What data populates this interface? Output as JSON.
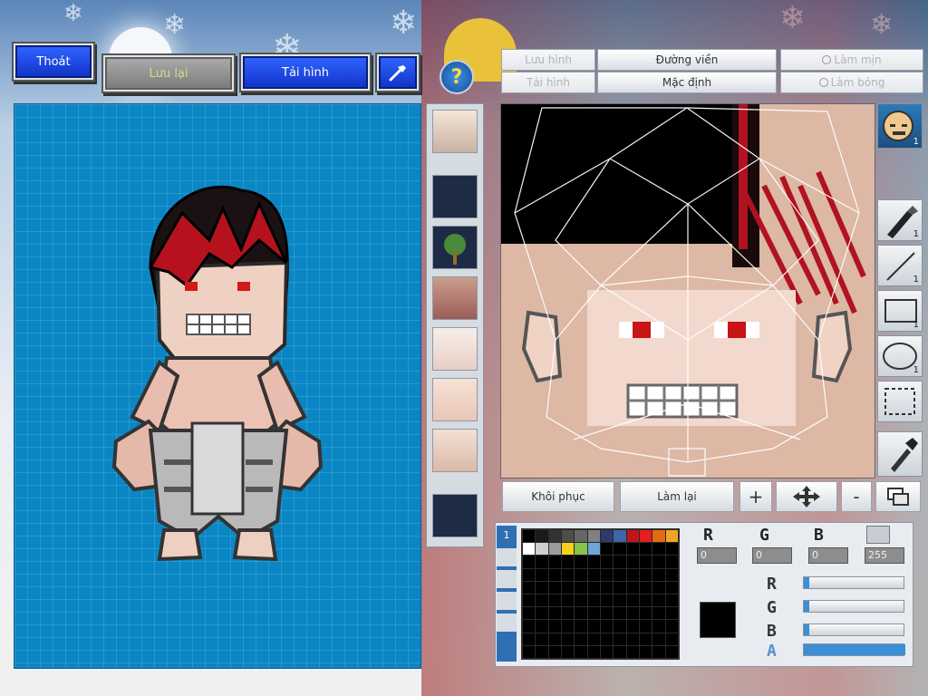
{
  "top_left": {
    "exit_label": "Thoát",
    "save_label": "Lưu lại",
    "reload_label": "Tải hình"
  },
  "top_right": {
    "save_image": "Lưu hình",
    "outline": "Đường viền",
    "smooth": "Làm mịn",
    "reload_image": "Tải hình",
    "default": "Mặc định",
    "shine": "Làm bóng"
  },
  "tools": {
    "face_count": "1",
    "pen_count": "1",
    "line_count": "1",
    "rect_count": "1",
    "ellipse_count": "1"
  },
  "bottom_toolbar": {
    "restore": "Khôi phục",
    "redo": "Làm lại",
    "zoom_in": "+",
    "zoom_out": "-"
  },
  "palette_tabs": [
    "1"
  ],
  "color_channels": {
    "r_label": "R",
    "g_label": "G",
    "b_label": "B",
    "r_value": "0",
    "g_value": "0",
    "b_value": "0",
    "a_value": "255"
  },
  "sliders": {
    "labels": [
      "R",
      "G",
      "B",
      "A"
    ],
    "values": [
      0,
      0,
      0,
      1
    ]
  },
  "palette_colors": [
    "#000000",
    "#1a1a1a",
    "#333333",
    "#4d4d4d",
    "#666666",
    "#808080",
    "#2e3a68",
    "#3c67a8",
    "#c2151b",
    "#e41f1f",
    "#e36b12",
    "#f3a428",
    "#ffffff",
    "#cfcfcf",
    "#9c9c9c",
    "#f2d21c",
    "#87c34a",
    "#6ca6d8"
  ],
  "current_color": "#000000"
}
